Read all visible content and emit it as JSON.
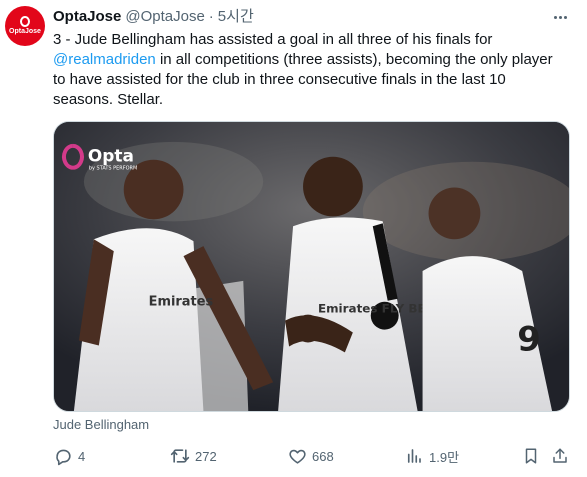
{
  "author": {
    "name": "OptaJose",
    "handle": "@OptaJose",
    "separator": "·",
    "time": "5시간",
    "avatar_text": "OptaJose"
  },
  "tweet": {
    "text_before": "3 - Jude Bellingham has assisted a goal in all three of his finals for ",
    "mention": "@realmadriden",
    "text_after": " in all competitions (three assists), becoming the only player to have assisted for the club in three consecutive finals in the last 10 seasons. Stellar."
  },
  "media": {
    "watermark": "Opta",
    "watermark_sub": "by STATS PERFORM",
    "jersey_text_left": "Emirates",
    "jersey_text_center": "Emirates FLY BETTER",
    "jersey_number_right": "9"
  },
  "caption": "Jude Bellingham",
  "actions": {
    "reply_count": "4",
    "retweet_count": "272",
    "like_count": "668",
    "views_count": "1.9만"
  },
  "colors": {
    "accent": "#1d9bf0",
    "secondary_text": "#536471",
    "brand_red": "#e2061a"
  },
  "icons": {
    "reply": "reply-icon",
    "retweet": "retweet-icon",
    "like": "heart-icon",
    "views": "views-icon",
    "bookmark": "bookmark-icon",
    "share": "share-icon",
    "more": "more-icon"
  }
}
